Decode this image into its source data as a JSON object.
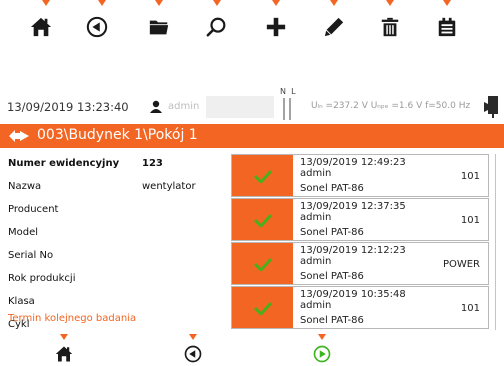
{
  "toolbar": {
    "buttons": [
      {
        "name": "home-button",
        "icon": "home-icon"
      },
      {
        "name": "back-button",
        "icon": "back-circle-icon"
      },
      {
        "name": "folder-button",
        "icon": "folder-icon"
      },
      {
        "name": "search-button",
        "icon": "search-icon"
      },
      {
        "name": "add-button",
        "icon": "plus-icon"
      },
      {
        "name": "edit-button",
        "icon": "pencil-icon"
      },
      {
        "name": "delete-button",
        "icon": "trash-icon"
      },
      {
        "name": "transfer-button",
        "icon": "data-transfer-icon"
      }
    ]
  },
  "status": {
    "datetime": "13/09/2019 13:23:40",
    "user": "admin",
    "phase_labels": "N  L",
    "voltages": "Uₗₙ =237.2 V Uₙₚₑ =1.6 V f=50.0 Hz"
  },
  "header": {
    "title": "003\\Budynek 1\\Pokój 1"
  },
  "details": {
    "rows": [
      {
        "label": "Numer ewidencyjny",
        "value": "123"
      },
      {
        "label": "Nazwa",
        "value": "wentylator"
      },
      {
        "label": "Producent",
        "value": ""
      },
      {
        "label": "Model",
        "value": ""
      },
      {
        "label": "Serial No",
        "value": ""
      },
      {
        "label": "Rok produkcji",
        "value": ""
      },
      {
        "label": "Klasa",
        "value": ""
      },
      {
        "label": "Cykl",
        "value": ""
      },
      {
        "label": "Termin kolejnego badania",
        "value": ""
      }
    ]
  },
  "measurements": [
    {
      "datetime": "13/09/2019 12:49:23",
      "user": "admin",
      "code": "101",
      "device": "Sonel PAT-86",
      "status": "pass"
    },
    {
      "datetime": "13/09/2019 12:37:35",
      "user": "admin",
      "code": "101",
      "device": "Sonel PAT-86",
      "status": "pass"
    },
    {
      "datetime": "13/09/2019 12:12:23",
      "user": "admin",
      "code": "POWER",
      "device": "Sonel PAT-86",
      "status": "pass"
    },
    {
      "datetime": "13/09/2019 10:35:48",
      "user": "admin",
      "code": "101",
      "device": "Sonel PAT-86",
      "status": "pass"
    }
  ],
  "bottombar": {
    "buttons": [
      {
        "name": "home-button",
        "icon": "home-icon"
      },
      {
        "name": "back-button",
        "icon": "back-circle-icon"
      },
      {
        "name": "start-button",
        "icon": "play-circle-icon"
      }
    ]
  },
  "colors": {
    "accent": "#f26522",
    "icon_dark": "#1a1a1a",
    "pass_check": "#4caf1a",
    "start_green": "#3cb521"
  }
}
